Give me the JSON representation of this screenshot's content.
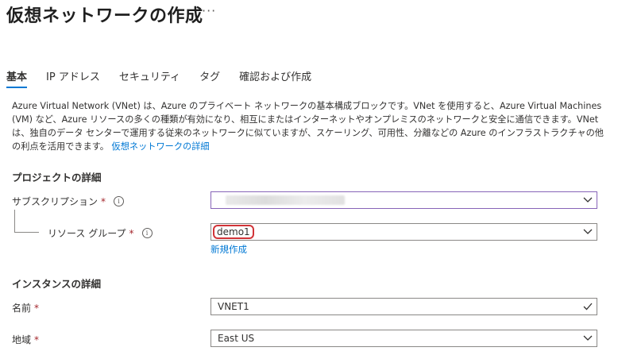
{
  "header": {
    "title": "仮想ネットワークの作成",
    "more_label": "···"
  },
  "tabs": [
    {
      "label": "基本",
      "active": true
    },
    {
      "label": "IP アドレス",
      "active": false
    },
    {
      "label": "セキュリティ",
      "active": false
    },
    {
      "label": "タグ",
      "active": false
    },
    {
      "label": "確認および作成",
      "active": false
    }
  ],
  "description": {
    "text": "Azure Virtual Network (VNet) は、Azure のプライベート ネットワークの基本構成ブロックです。VNet を使用すると、Azure Virtual Machines (VM) など、Azure リソースの多くの種類が有効になり、相互にまたはインターネットやオンプレミスのネットワークと安全に通信できます。VNet は、独自のデータ センターで運用する従来のネットワークに似ていますが、スケーリング、可用性、分離などの Azure のインフラストラクチャの他の利点を活用できます。",
    "link": "仮想ネットワークの詳細"
  },
  "project": {
    "title": "プロジェクトの詳細",
    "subscription_label": "サブスクリプション",
    "resource_group_label": "リソース グループ",
    "resource_group_value": "demo1",
    "new_link": "新規作成"
  },
  "instance": {
    "title": "インスタンスの詳細",
    "name_label": "名前",
    "name_value": "VNET1",
    "region_label": "地域",
    "region_value": "East US"
  },
  "common": {
    "required_mark": "*",
    "info_glyph": "i"
  },
  "colors": {
    "accent": "#0078d4",
    "required": "#a4262c",
    "highlight": "#d13438",
    "focus_border": "#8764b8"
  }
}
